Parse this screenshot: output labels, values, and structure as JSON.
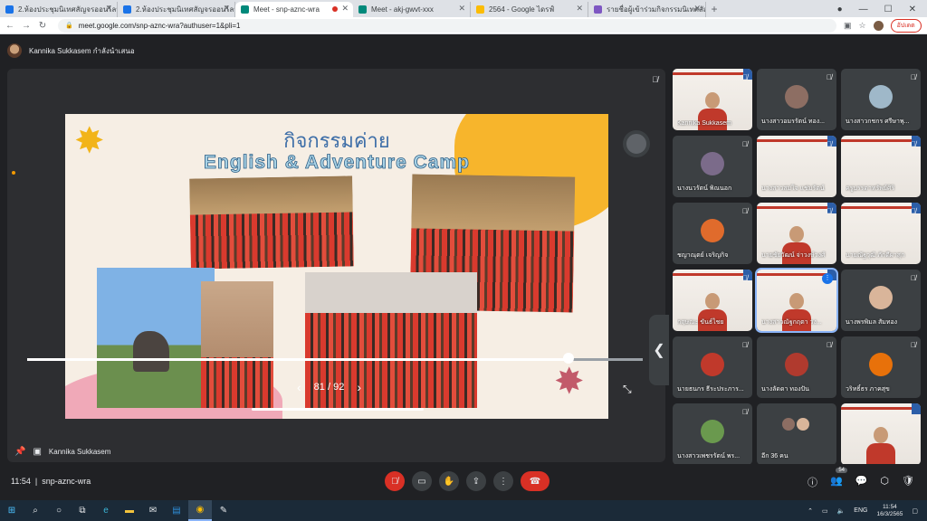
{
  "tabs": [
    {
      "label": "2.ห้องประชุมนิเทศสัญจรออนไลน์ (กา",
      "favicon_color": "#1a73e8",
      "active": false
    },
    {
      "label": "2.ห้องประชุมนิเทศสัญจรออนไลน์ (กา",
      "favicon_color": "#1a73e8",
      "active": false
    },
    {
      "label": "Meet - snp-aznc-wra",
      "favicon_color": "#00897b",
      "active": true
    },
    {
      "label": "Meet - akj-gwvt-xxx",
      "favicon_color": "#00897b",
      "active": false
    },
    {
      "label": "2564 - Google ไดรฟ์",
      "favicon_color": "#fbbc04",
      "active": false
    },
    {
      "label": "รายชื่อผู้เข้าร่วมกิจกรรมนิเทศสัญจรฯ",
      "favicon_color": "#7e57c2",
      "active": false
    }
  ],
  "browser": {
    "url": "meet.google.com/snp-aznc-wra?authuser=1&pli=1",
    "update_label": "อัปเดต"
  },
  "presenter": {
    "banner_text": "Kannika Sukkasem กำลังนำเสนอ",
    "name": "Kannika Sukkasem"
  },
  "slide": {
    "title_th": "กิจกรรมค่าย",
    "title_en": "English & Adventure Camp",
    "page_current": 81,
    "page_total": 92,
    "page_text": "81 / 92",
    "progress": 0.88,
    "accent_yellow": "#f7b52c",
    "accent_pink": "#f0a9b8"
  },
  "participants": [
    {
      "name": "Kannika Sukkasem",
      "kind": "slide-person",
      "mic": "off"
    },
    {
      "name": "นางสาวอมรรัตน์ ทอง...",
      "kind": "avatar",
      "avatar_color": "#8d6e63",
      "mic": "off"
    },
    {
      "name": "นางสาวกชกร ศรีษาพุ...",
      "kind": "avatar",
      "avatar_color": "#9fb8c9",
      "mic": "off"
    },
    {
      "name": "นางนวรัตน์ พิณนอก",
      "kind": "avatar",
      "avatar_color": "#7b6b8a",
      "mic": "off"
    },
    {
      "name": "นางสาวสมใจ แช่มรัตน์",
      "kind": "slide",
      "mic": "off"
    },
    {
      "name": "ครูบรรดาทรัพย์ศิริ",
      "kind": "slide",
      "mic": "off"
    },
    {
      "name": "ชญาณุตย์ เจริญกิจ",
      "kind": "avatar",
      "avatar_color": "#e06b2c",
      "mic": "off"
    },
    {
      "name": "นายชัยวัฒน์ จ่าวงษ์วงศ์",
      "kind": "slide-person",
      "mic": "off"
    },
    {
      "name": "นายณัฐวุฒิ ภักดีผาสุก",
      "kind": "slide",
      "mic": "off"
    },
    {
      "name": "กฤษณะ ขันธ์ไชย",
      "kind": "slide-person",
      "mic": "off"
    },
    {
      "name": "นางสาวณัฐกฤตา วง...",
      "kind": "slide-person",
      "mic": "active",
      "highlight": true
    },
    {
      "name": "นางพรพิมล สัมทอง",
      "kind": "avatar",
      "avatar_color": "#d9b59a",
      "mic": "off"
    },
    {
      "name": "นายธนกร ธีระประภาร...",
      "kind": "avatar",
      "avatar_color": "#c0392b",
      "mic": "off"
    },
    {
      "name": "นางลัดดา ทองปัน",
      "kind": "avatar",
      "avatar_color": "#b03a2e",
      "mic": "off"
    },
    {
      "name": "วริทธิ์ธร ภาคสุข",
      "kind": "avatar",
      "avatar_color": "#e8710a",
      "mic": "off"
    },
    {
      "name": "นางสาวเพชรรัตน์ พร...",
      "kind": "avatar",
      "avatar_color": "#6a994e",
      "mic": "off"
    },
    {
      "name": "อีก 36 คน",
      "kind": "more",
      "mic": "none"
    },
    {
      "name": "",
      "kind": "slide-person",
      "mic": "none"
    }
  ],
  "toolbar": {
    "time": "11:54",
    "meeting_code": "snp-aznc-wra",
    "people_count": "54"
  },
  "taskbar": {
    "language": "ENG",
    "time": "11:54",
    "date": "16/3/2565"
  }
}
